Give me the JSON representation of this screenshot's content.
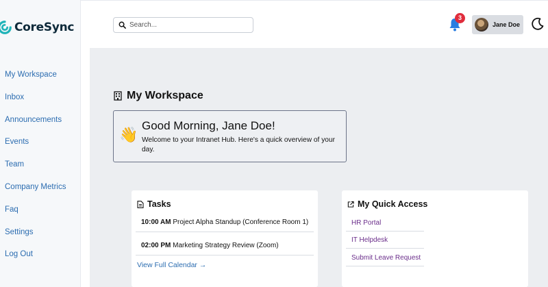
{
  "app": {
    "name": "CoreSync",
    "accent": "#2b6cb0",
    "brand_teal": "#1fb3b8"
  },
  "sidebar": {
    "items": [
      {
        "label": "My Workspace"
      },
      {
        "label": "Inbox"
      },
      {
        "label": "Announcements"
      },
      {
        "label": "Events"
      },
      {
        "label": "Team"
      },
      {
        "label": "Company Metrics"
      },
      {
        "label": "Faq"
      },
      {
        "label": "Settings"
      },
      {
        "label": "Log Out"
      }
    ]
  },
  "topbar": {
    "search_placeholder": "Search...",
    "notifications_count": "3",
    "user_name": "Jane Doe",
    "icons": [
      "search-icon",
      "bell-icon",
      "moon-icon"
    ]
  },
  "main": {
    "title": "My Workspace",
    "welcome": {
      "heading": "Good Morning, Jane Doe!",
      "text": "Welcome to your Intranet Hub. Here's a quick overview of your day.",
      "emoji": "👋"
    },
    "tasks": {
      "title": "Tasks",
      "items": [
        {
          "time": "10:00 AM",
          "text": "Project Alpha Standup (Conference Room 1)"
        },
        {
          "time": "02:00 PM",
          "text": "Marketing Strategy Review (Zoom)"
        }
      ],
      "link": "View Full Calendar →"
    },
    "quick_access": {
      "title": "My Quick Access",
      "links": [
        "HR Portal",
        "IT Helpdesk",
        "Submit Leave Request"
      ]
    }
  }
}
